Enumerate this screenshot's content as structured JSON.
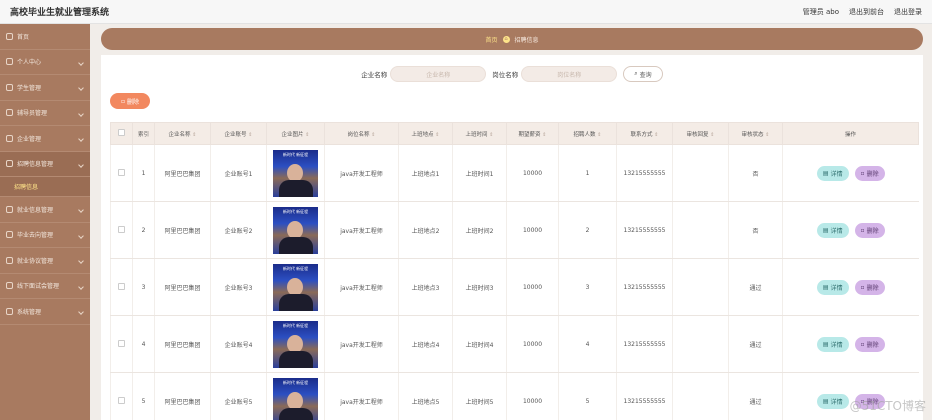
{
  "app": {
    "title": "高校毕业生就业管理系统",
    "user_label": "管理员 abo",
    "back_label": "退出到前台",
    "logout_label": "退出登录"
  },
  "sidebar": {
    "items": [
      {
        "label": "首页"
      },
      {
        "label": "个人中心"
      },
      {
        "label": "学生管理"
      },
      {
        "label": "辅导员管理"
      },
      {
        "label": "企业管理"
      },
      {
        "label": "招聘信息管理"
      },
      {
        "label": "就业信息管理"
      },
      {
        "label": "毕业去向管理"
      },
      {
        "label": "就业协议管理"
      },
      {
        "label": "线下面试会管理"
      },
      {
        "label": "系统管理"
      }
    ],
    "sub_item": "招聘信息"
  },
  "breadcrumb": {
    "first": "首页",
    "icon": "home",
    "second": "招聘信息"
  },
  "search": {
    "field1_label": "企业名称",
    "field1_placeholder": "企业名称",
    "field2_label": "岗位名称",
    "field2_placeholder": "岗位名称",
    "button_label": "查询"
  },
  "toolbar": {
    "delete_label": "删除"
  },
  "table": {
    "headers": [
      "",
      "索引",
      "企业名称",
      "企业账号",
      "企业图片",
      "岗位名称",
      "上班地点",
      "上班时间",
      "期望薪资",
      "招聘人数",
      "联系方式",
      "审核回复",
      "审核状态",
      "操作"
    ],
    "thumb_caption": "新时代 新征程",
    "rows": [
      {
        "index": "1",
        "company": "阿里巴巴集团",
        "account": "企业账号1",
        "position": "java开发工程师",
        "location": "上班地点1",
        "time": "上班时间1",
        "salary": "10000",
        "count": "1",
        "contact": "13215555555",
        "reply": "",
        "status": "否",
        "detail": "详情",
        "del": "删除"
      },
      {
        "index": "2",
        "company": "阿里巴巴集团",
        "account": "企业账号2",
        "position": "java开发工程师",
        "location": "上班地点2",
        "time": "上班时间2",
        "salary": "10000",
        "count": "2",
        "contact": "13215555555",
        "reply": "",
        "status": "否",
        "detail": "详情",
        "del": "删除"
      },
      {
        "index": "3",
        "company": "阿里巴巴集团",
        "account": "企业账号3",
        "position": "java开发工程师",
        "location": "上班地点3",
        "time": "上班时间3",
        "salary": "10000",
        "count": "3",
        "contact": "13215555555",
        "reply": "",
        "status": "通过",
        "detail": "详情",
        "del": "删除"
      },
      {
        "index": "4",
        "company": "阿里巴巴集团",
        "account": "企业账号4",
        "position": "java开发工程师",
        "location": "上班地点4",
        "time": "上班时间4",
        "salary": "10000",
        "count": "4",
        "contact": "13215555555",
        "reply": "",
        "status": "通过",
        "detail": "详情",
        "del": "删除"
      },
      {
        "index": "5",
        "company": "阿里巴巴集团",
        "account": "企业账号5",
        "position": "java开发工程师",
        "location": "上班地点5",
        "time": "上班时间5",
        "salary": "10000",
        "count": "5",
        "contact": "13215555555",
        "reply": "",
        "status": "通过",
        "detail": "详情",
        "del": "删除"
      }
    ]
  },
  "watermark": "@51CTO博客",
  "colors": {
    "sidebar": "#a87a60",
    "accent_orange": "#f2885f",
    "detail_button": "#b8e9e8",
    "delete_button": "#d4b4e8"
  }
}
